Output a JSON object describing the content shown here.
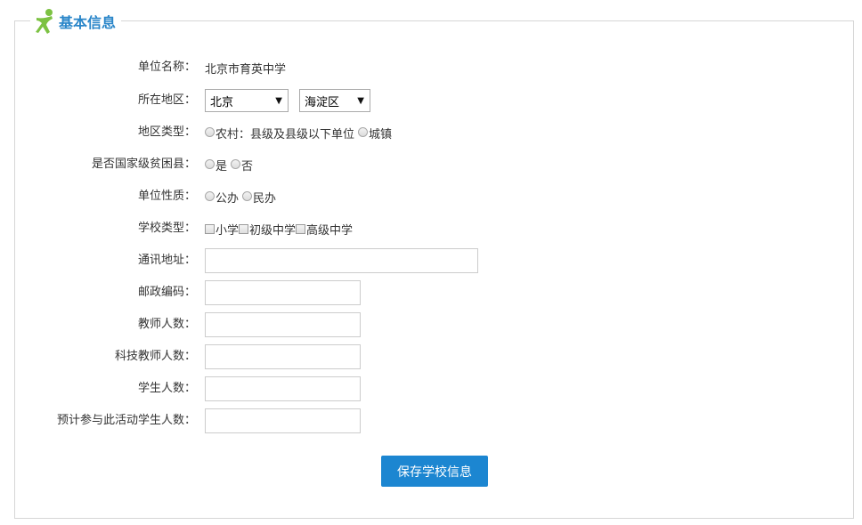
{
  "section": {
    "title": "基本信息",
    "icon": "running-person-icon"
  },
  "form": {
    "unit_name": {
      "label": "单位名称：",
      "value": "北京市育英中学"
    },
    "region": {
      "label": "所在地区：",
      "province": "北京",
      "district": "海淀区"
    },
    "region_type": {
      "label": "地区类型：",
      "options": [
        "农村：县级及县级以下单位",
        "城镇"
      ]
    },
    "poverty_county": {
      "label": "是否国家级贫困县：",
      "options": [
        "是",
        "否"
      ]
    },
    "unit_nature": {
      "label": "单位性质：",
      "options": [
        "公办",
        "民办"
      ]
    },
    "school_type": {
      "label": "学校类型：",
      "options": [
        "小学",
        "初级中学",
        "高级中学"
      ]
    },
    "address": {
      "label": "通讯地址：",
      "value": ""
    },
    "postal_code": {
      "label": "邮政编码：",
      "value": ""
    },
    "teacher_count": {
      "label": "教师人数：",
      "value": ""
    },
    "tech_teacher_count": {
      "label": "科技教师人数：",
      "value": ""
    },
    "student_count": {
      "label": "学生人数：",
      "value": ""
    },
    "expected_students": {
      "label": "预计参与此活动学生人数：",
      "value": ""
    }
  },
  "actions": {
    "save_label": "保存学校信息"
  },
  "colors": {
    "accent": "#1c86d1",
    "title": "#2a86c9",
    "icon_green": "#7cc242"
  }
}
